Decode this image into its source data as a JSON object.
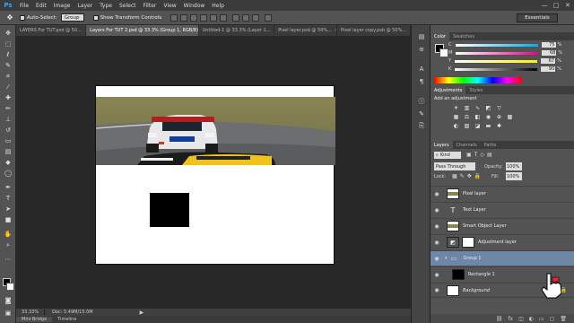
{
  "menubar": {
    "logo": "Ps",
    "items": [
      "File",
      "Edit",
      "Image",
      "Layer",
      "Type",
      "Select",
      "Filter",
      "View",
      "Window",
      "Help"
    ],
    "window_controls": [
      "—",
      "□",
      "✕"
    ]
  },
  "options": {
    "auto_select_label": "Auto-Select:",
    "auto_select_value": "Group",
    "show_transform_label": "Show Transform Controls",
    "workspace": "Essentials"
  },
  "tabs": [
    {
      "label": "LAYERS For TUT.psd @ 50...",
      "active": false
    },
    {
      "label": "Layers For TUT 2.psd @ 33.3% (Group 1, RGB/8)",
      "active": true
    },
    {
      "label": "Untitled-1 @ 33.3% (Layer 1...",
      "active": false
    },
    {
      "label": "Pixel layer.psd @ 50%...",
      "active": false
    },
    {
      "label": "Pixel layer copy.psb @ 50%...",
      "active": false
    }
  ],
  "status": {
    "zoom": "33.33%",
    "doc": "Doc: 5.49M/15.0M"
  },
  "bottom_tabs": [
    "Mini Bridge",
    "Timeline"
  ],
  "color_panel": {
    "tabs": [
      "Color",
      "Swatches"
    ],
    "channels": [
      {
        "label": "C",
        "value": "75"
      },
      {
        "label": "M",
        "value": "68"
      },
      {
        "label": "Y",
        "value": "67"
      },
      {
        "label": "K",
        "value": "90"
      }
    ],
    "unit": "%"
  },
  "adjustments": {
    "tabs": [
      "Adjustments",
      "Styles"
    ],
    "title": "Add an adjustment"
  },
  "layers_panel": {
    "tabs": [
      "Layers",
      "Channels",
      "Paths"
    ],
    "kind": "Kind",
    "blend_mode": "Pass Through",
    "opacity_label": "Opacity:",
    "opacity": "100%",
    "lock_label": "Lock:",
    "fill_label": "Fill:",
    "fill": "100%",
    "layers": [
      {
        "name": "Pixel layer",
        "type": "pixel",
        "selected": false
      },
      {
        "name": "Text Layer",
        "type": "text",
        "selected": false
      },
      {
        "name": "Smart Object Layer",
        "type": "smart",
        "selected": false
      },
      {
        "name": "Adjustment layer",
        "type": "adjust",
        "selected": false
      },
      {
        "name": "Group 1",
        "type": "group",
        "selected": true
      },
      {
        "name": "Rectangle 1",
        "type": "shape",
        "selected": false
      },
      {
        "name": "Background",
        "type": "bg",
        "selected": false
      }
    ]
  },
  "colors": {
    "accent": "#31a8ff",
    "selected_layer": "#6e86a8",
    "fg": "#000000",
    "bg": "#ffffff"
  }
}
